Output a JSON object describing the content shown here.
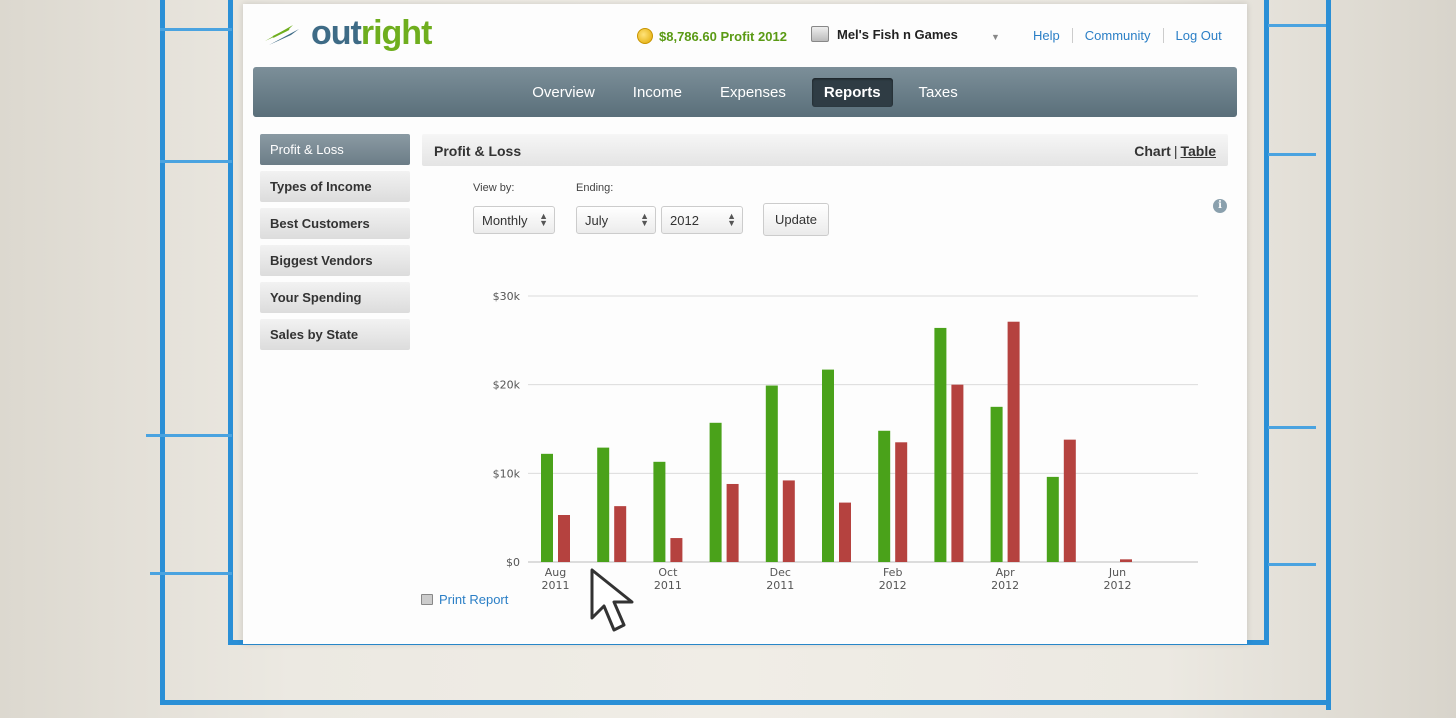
{
  "brand": {
    "logo_out": "out",
    "logo_right": "right"
  },
  "header": {
    "profit_text": "$8,786.60 Profit 2012",
    "business_name": "Mel's Fish n Games",
    "links": [
      "Help",
      "Community",
      "Log Out"
    ]
  },
  "nav": {
    "tabs": [
      {
        "label": "Overview",
        "active": false
      },
      {
        "label": "Income",
        "active": false
      },
      {
        "label": "Expenses",
        "active": false
      },
      {
        "label": "Reports",
        "active": true
      },
      {
        "label": "Taxes",
        "active": false
      }
    ]
  },
  "sidebar": {
    "items": [
      {
        "label": "Profit & Loss",
        "active": true
      },
      {
        "label": "Types of Income",
        "active": false
      },
      {
        "label": "Best Customers",
        "active": false
      },
      {
        "label": "Biggest Vendors",
        "active": false
      },
      {
        "label": "Your Spending",
        "active": false
      },
      {
        "label": "Sales by State",
        "active": false
      }
    ]
  },
  "report": {
    "title": "Profit & Loss",
    "toggle_chart": "Chart",
    "toggle_sep": "|",
    "toggle_table": "Table",
    "view_by_label": "View by:",
    "view_by_value": "Monthly",
    "ending_label": "Ending:",
    "ending_month": "July",
    "ending_year": "2012",
    "update_label": "Update",
    "print_label": "Print Report"
  },
  "colors": {
    "income": "#4aa21a",
    "expense": "#b5423f",
    "accent": "#2b7fc6"
  },
  "chart_data": {
    "type": "bar",
    "categories": [
      "Aug 2011",
      "Sep 2011",
      "Oct 2011",
      "Nov 2011",
      "Dec 2011",
      "Jan 2012",
      "Feb 2012",
      "Mar 2012",
      "Apr 2012",
      "May 2012",
      "Jun 2012",
      "Jul 2012"
    ],
    "tick_labels": [
      {
        "index": 0,
        "line1": "Aug",
        "line2": "2011"
      },
      {
        "index": 2,
        "line1": "Oct",
        "line2": "2011"
      },
      {
        "index": 4,
        "line1": "Dec",
        "line2": "2011"
      },
      {
        "index": 6,
        "line1": "Feb",
        "line2": "2012"
      },
      {
        "index": 8,
        "line1": "Apr",
        "line2": "2012"
      },
      {
        "index": 10,
        "line1": "Jun",
        "line2": "2012"
      }
    ],
    "series": [
      {
        "color": "#4aa21a",
        "values": [
          12200,
          12900,
          11300,
          15700,
          19900,
          21700,
          14800,
          26400,
          17500,
          9600,
          0,
          0
        ]
      },
      {
        "color": "#b5423f",
        "values": [
          5300,
          6300,
          2700,
          8800,
          9200,
          6700,
          13500,
          20000,
          27100,
          13800,
          300,
          0
        ]
      }
    ],
    "yticks": [
      "$0",
      "$10k",
      "$20k",
      "$30k"
    ],
    "ytick_values": [
      0,
      10000,
      20000,
      30000
    ],
    "ylim": [
      0,
      30000
    ],
    "grid": true,
    "legend": false
  }
}
